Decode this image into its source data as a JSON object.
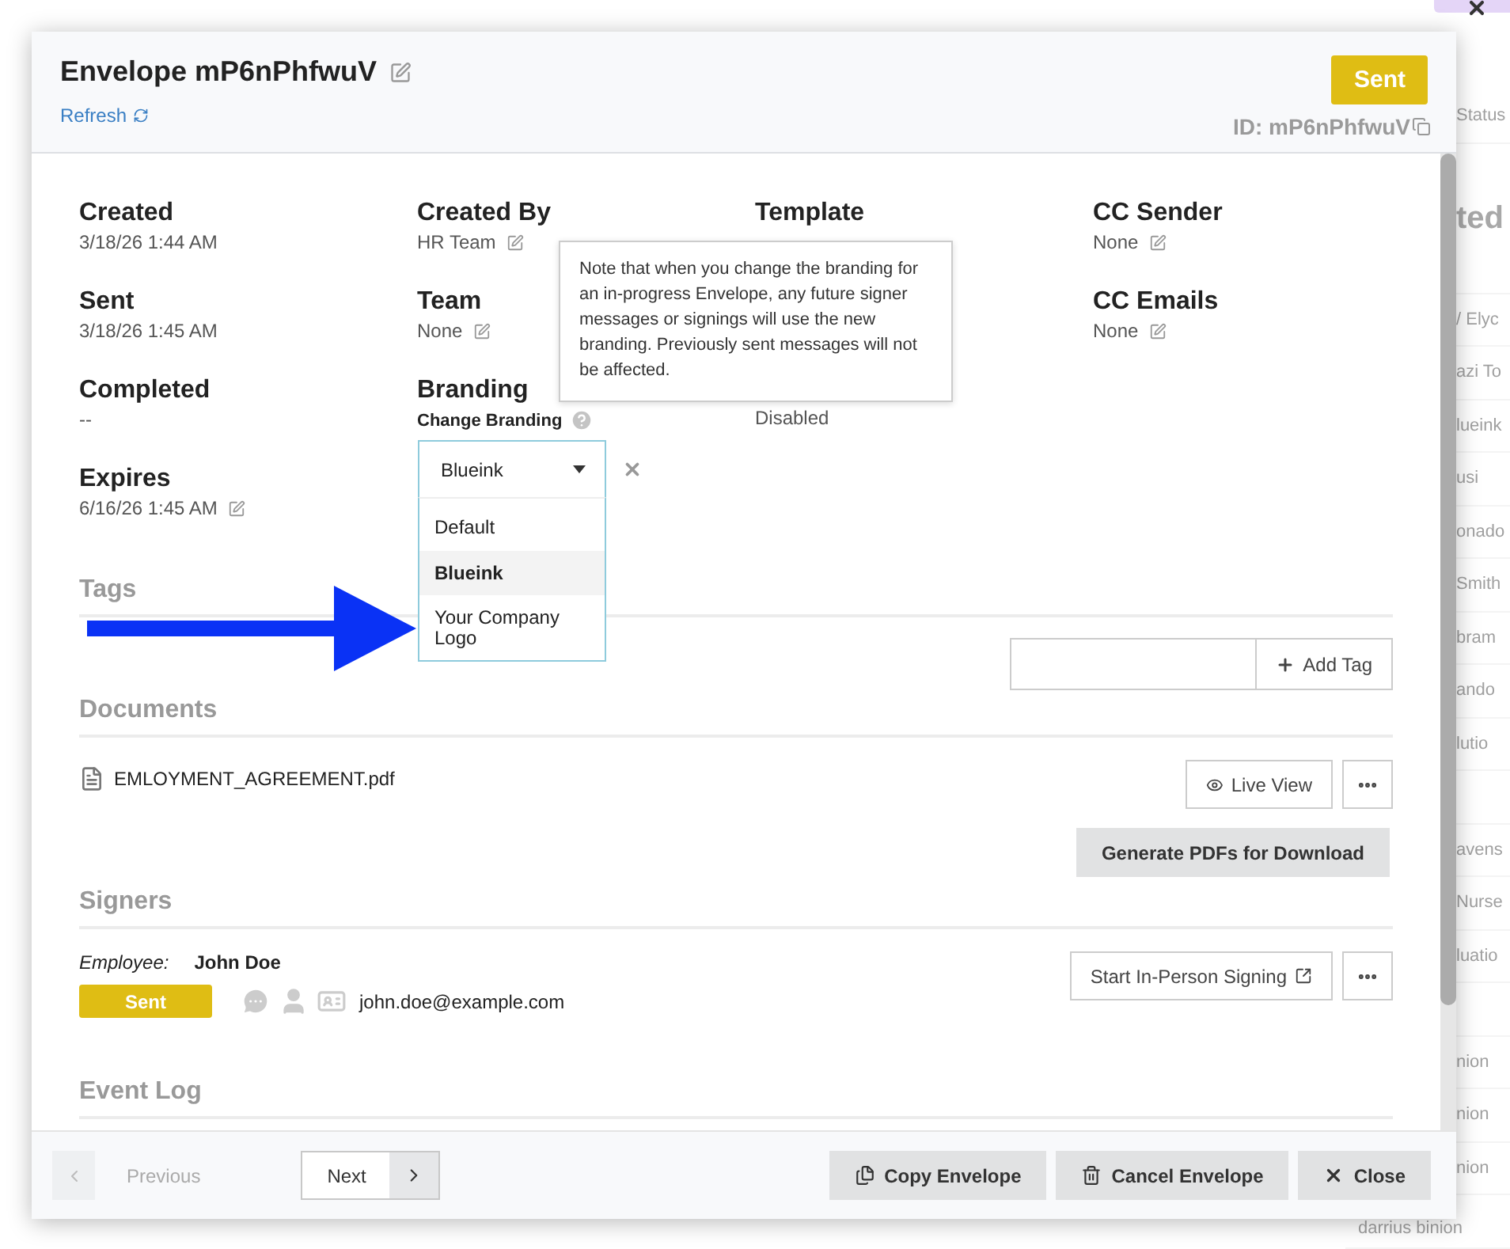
{
  "background_list": [
    {
      "kind": "header",
      "text": "Status"
    },
    {
      "kind": "heading",
      "text": "ted"
    },
    {
      "kind": "row",
      "text": "/ Elyc"
    },
    {
      "kind": "row",
      "text": "azi To"
    },
    {
      "kind": "row",
      "text": "lueink"
    },
    {
      "kind": "row",
      "text": "usi"
    },
    {
      "kind": "row",
      "text": "onado"
    },
    {
      "kind": "row",
      "text": "Smith"
    },
    {
      "kind": "row",
      "text": "bram"
    },
    {
      "kind": "row",
      "text": "ando"
    },
    {
      "kind": "row",
      "text": "lutio"
    },
    {
      "kind": "blank"
    },
    {
      "kind": "row",
      "text": "avens"
    },
    {
      "kind": "row",
      "text": "Nurse"
    },
    {
      "kind": "row",
      "text": "luatio"
    },
    {
      "kind": "blank"
    },
    {
      "kind": "row",
      "text": "nion"
    },
    {
      "kind": "row",
      "text": "nion"
    },
    {
      "kind": "row",
      "text": "nion"
    },
    {
      "kind": "full",
      "text": "darrius binion"
    }
  ],
  "envelope": {
    "title": "Envelope mP6nPhfwuV",
    "refresh": "Refresh",
    "status": "Sent",
    "id": "ID: mP6nPhfwuV"
  },
  "field_columns": [
    [
      {
        "kind": "field",
        "label": "Created",
        "value": "3/18/26 1:44 AM",
        "editable": false
      },
      {
        "kind": "field",
        "label": "Sent",
        "value": "3/18/26 1:45 AM",
        "editable": false
      },
      {
        "kind": "field",
        "label": "Completed",
        "value": "--",
        "editable": false
      },
      {
        "kind": "field",
        "label": "Expires",
        "value": "6/16/26 1:45 AM",
        "editable": true
      }
    ],
    [
      {
        "kind": "field",
        "label": "Created By",
        "value": "HR Team",
        "editable": true
      },
      {
        "kind": "field",
        "label": "Team",
        "value": "None",
        "editable": true
      },
      {
        "kind": "branding",
        "label": "Branding",
        "sublabel": "Change Branding",
        "select_value": "Blueink",
        "options": [
          {
            "label": "Default",
            "selected": false
          },
          {
            "label": "Blueink",
            "selected": true
          },
          {
            "label": "Your Company Logo",
            "selected": false
          }
        ],
        "tooltip": "Note that when you change the branding for an in-progress Envelope, any future signer messages or signings will use the new branding. Previously sent messages will not be affected."
      }
    ],
    [
      {
        "kind": "field",
        "label": "Template"
      },
      {
        "kind": "gap"
      },
      {
        "kind": "field",
        "value": "Disabled",
        "editable": false
      }
    ],
    [
      {
        "kind": "field",
        "label": "CC Sender",
        "value": "None",
        "editable": true
      },
      {
        "kind": "field",
        "label": "CC Emails",
        "value": "None",
        "editable": true
      }
    ]
  ],
  "tags": {
    "heading": "Tags",
    "add_button": "Add Tag"
  },
  "documents": {
    "heading": "Documents",
    "files": [
      {
        "name": "EMLOYMENT_AGREEMENT.pdf",
        "view_button": "Live View"
      }
    ],
    "generate_button": "Generate PDFs for Download"
  },
  "signers": {
    "heading": "Signers",
    "items": [
      {
        "role": "Employee:",
        "name": "John Doe",
        "status": "Sent",
        "email": "john.doe@example.com",
        "action_button": "Start In-Person Signing"
      }
    ]
  },
  "event_log": {
    "heading": "Event Log"
  },
  "footer": {
    "previous": {
      "label": "Previous",
      "disabled": true
    },
    "next": {
      "label": "Next",
      "disabled": false
    },
    "buttons": [
      {
        "kind": "copy",
        "label": "Copy Envelope"
      },
      {
        "kind": "cancel",
        "label": "Cancel Envelope"
      },
      {
        "kind": "close",
        "label": "Close"
      }
    ]
  }
}
